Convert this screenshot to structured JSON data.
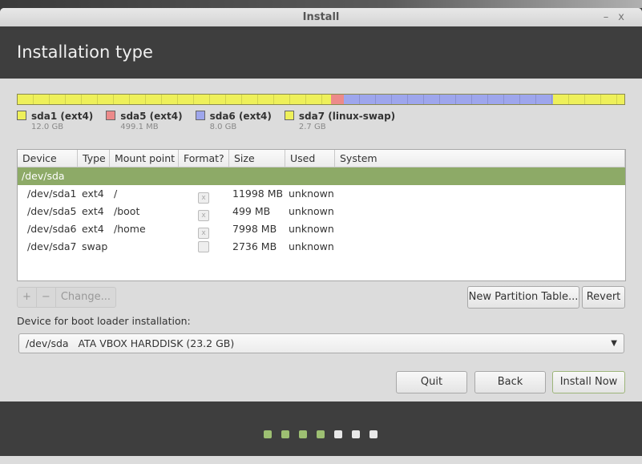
{
  "window": {
    "title": "Install",
    "minimize_label": "–",
    "close_label": "x"
  },
  "header": {
    "title": "Installation type"
  },
  "partition_bar": {
    "segments": [
      {
        "name": "sda1",
        "fraction": 0.517,
        "color": "#eef05a"
      },
      {
        "name": "sda5",
        "fraction": 0.021,
        "color": "#ec8a8a"
      },
      {
        "name": "sda6",
        "fraction": 0.345,
        "color": "#9ea6ec"
      },
      {
        "name": "sda7",
        "fraction": 0.117,
        "color": "#eef05a"
      }
    ]
  },
  "legend": [
    {
      "name": "sda1 (ext4)",
      "size": "12.0 GB",
      "color": "#eef05a"
    },
    {
      "name": "sda5 (ext4)",
      "size": "499.1 MB",
      "color": "#ec8a8a"
    },
    {
      "name": "sda6 (ext4)",
      "size": "8.0 GB",
      "color": "#9ea6ec"
    },
    {
      "name": "sda7 (linux-swap)",
      "size": "2.7 GB",
      "color": "#eef05a"
    }
  ],
  "table": {
    "columns": [
      "Device",
      "Type",
      "Mount point",
      "Format?",
      "Size",
      "Used",
      "System"
    ],
    "group": "/dev/sda",
    "rows": [
      {
        "device": "/dev/sda1",
        "type": "ext4",
        "mount": "/",
        "format": "x",
        "size": "11998 MB",
        "used": "unknown",
        "system": ""
      },
      {
        "device": "/dev/sda5",
        "type": "ext4",
        "mount": "/boot",
        "format": "x",
        "size": "499 MB",
        "used": "unknown",
        "system": ""
      },
      {
        "device": "/dev/sda6",
        "type": "ext4",
        "mount": "/home",
        "format": "x",
        "size": "7998 MB",
        "used": "unknown",
        "system": ""
      },
      {
        "device": "/dev/sda7",
        "type": "swap",
        "mount": "",
        "format": "",
        "size": "2736 MB",
        "used": "unknown",
        "system": ""
      }
    ]
  },
  "tools": {
    "add": "+",
    "remove": "−",
    "change": "Change..."
  },
  "buttons": {
    "new_table": "New Partition Table...",
    "revert": "Revert",
    "quit": "Quit",
    "back": "Back",
    "install": "Install Now"
  },
  "bootloader": {
    "label": "Device for boot loader installation:",
    "value": "/dev/sda   ATA VBOX HARDDISK (23.2 GB)",
    "arrow": "▼"
  },
  "progress": {
    "steps_total": 7,
    "steps_done": 4,
    "done_color": "#9dbf72",
    "todo_color": "#e8e8e8"
  }
}
